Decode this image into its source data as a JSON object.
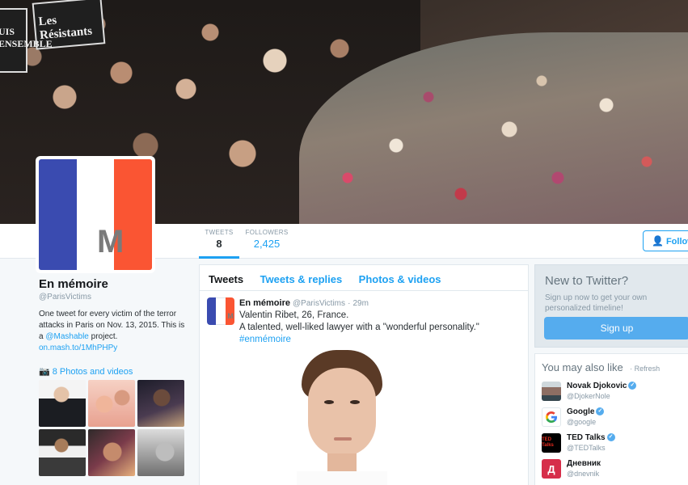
{
  "banner": {
    "sign_text": "Les Résistants",
    "sign_left_text": "UIS ENSEMBLE"
  },
  "stats": {
    "tweets_label": "TWEETS",
    "tweets_value": "8",
    "followers_label": "FOLLOWERS",
    "followers_value": "2,425"
  },
  "follow_button": {
    "label": "Follow"
  },
  "avatar": {
    "letter": "M"
  },
  "profile": {
    "name": "En mémoire",
    "handle": "@ParisVictims",
    "bio_part1": "One tweet for every victim of the terror attacks in Paris on Nov. 13, 2015. This is a",
    "bio_mention": "@Mashable",
    "bio_part2": "project.",
    "bio_link": "on.mash.to/1MhPHPy",
    "photos_label": "8 Photos and videos"
  },
  "timeline": {
    "tabs": [
      "Tweets",
      "Tweets & replies",
      "Photos & videos"
    ],
    "tweet": {
      "name": "En mémoire",
      "handle": "@ParisVictims",
      "time": "29m",
      "line1": "Valentin Ribet, 26, France.",
      "line2": "A talented, well-liked lawyer with a \"wonderful personality.\"",
      "hashtag": "#enmémoire"
    }
  },
  "signup": {
    "heading": "New to Twitter?",
    "text": "Sign up now to get your own personalized timeline!",
    "button": "Sign up"
  },
  "suggestions": {
    "heading": "You may also like",
    "refresh": "Refresh",
    "accounts": [
      {
        "name": "Novak Djokovic",
        "handle": "@DjokerNole",
        "verified": true,
        "icon": "person-avatar"
      },
      {
        "name": "Google",
        "handle": "@google",
        "verified": true,
        "icon": "google-logo"
      },
      {
        "name": "TED Talks",
        "handle": "@TEDTalks",
        "verified": true,
        "icon": "ted-logo",
        "icon_text": "TED Talks"
      },
      {
        "name": "Дневник",
        "handle": "@dnevnik",
        "verified": false,
        "icon": "dnevnik-logo",
        "icon_text": "Д"
      }
    ]
  },
  "colors": {
    "accent": "#1da1f2",
    "flag_blue": "#3a4bb0",
    "flag_red": "#fa5533",
    "signup_button": "#55acee"
  }
}
